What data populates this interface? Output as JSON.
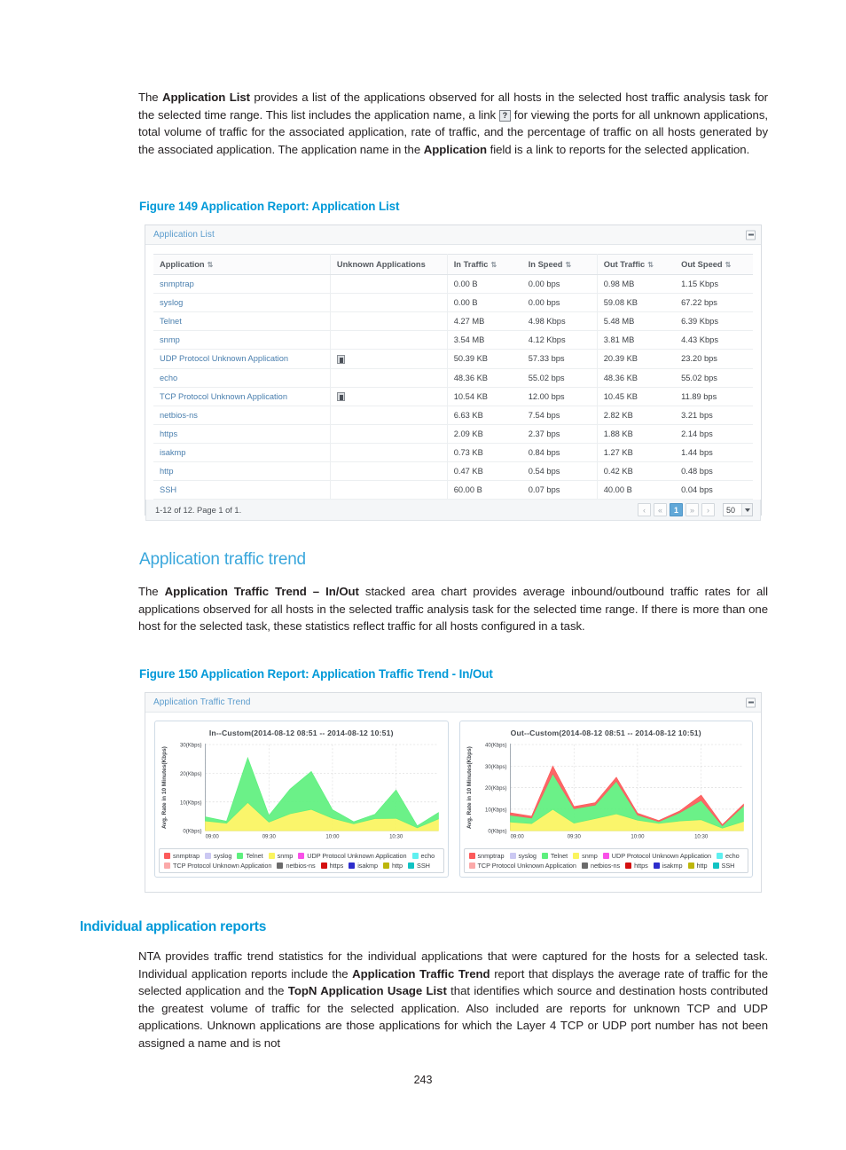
{
  "document": {
    "page_number": "243"
  },
  "intro_paragraph": {
    "segments": [
      {
        "text": "The ",
        "bold": false
      },
      {
        "text": "Application List",
        "bold": true
      },
      {
        "text": " provides a list of the applications observed for all hosts in the selected host traffic analysis task for the selected time range. This list includes the application name, a link ",
        "bold": false
      },
      {
        "text": "[?]",
        "bold": false,
        "icon": true
      },
      {
        "text": " for viewing the ports for all unknown applications, total volume of traffic for the associated application, rate of traffic, and the percentage of traffic on all hosts generated by the associated application. The application name in the ",
        "bold": false
      },
      {
        "text": "Application",
        "bold": true
      },
      {
        "text": " field is a link to reports for the selected application.",
        "bold": false
      }
    ]
  },
  "figure_149": {
    "caption": "Figure 149 Application Report: Application List",
    "panel_title": "Application List",
    "collapse_icon": "minus-icon",
    "table": {
      "columns": [
        {
          "label": "Application",
          "sortable": true
        },
        {
          "label": "Unknown Applications",
          "sortable": false
        },
        {
          "label": "In Traffic",
          "sortable": true
        },
        {
          "label": "In Speed",
          "sortable": true
        },
        {
          "label": "Out Traffic",
          "sortable": true
        },
        {
          "label": "Out Speed",
          "sortable": true
        }
      ],
      "rows": [
        {
          "application": "snmptrap",
          "unknown_icon": false,
          "in_traffic": "0.00 B",
          "in_speed": "0.00 bps",
          "out_traffic": "0.98 MB",
          "out_speed": "1.15 Kbps"
        },
        {
          "application": "syslog",
          "unknown_icon": false,
          "in_traffic": "0.00 B",
          "in_speed": "0.00 bps",
          "out_traffic": "59.08 KB",
          "out_speed": "67.22 bps"
        },
        {
          "application": "Telnet",
          "unknown_icon": false,
          "in_traffic": "4.27 MB",
          "in_speed": "4.98 Kbps",
          "out_traffic": "5.48 MB",
          "out_speed": "6.39 Kbps"
        },
        {
          "application": "snmp",
          "unknown_icon": false,
          "in_traffic": "3.54 MB",
          "in_speed": "4.12 Kbps",
          "out_traffic": "3.81 MB",
          "out_speed": "4.43 Kbps"
        },
        {
          "application": "UDP Protocol Unknown Application",
          "unknown_icon": true,
          "in_traffic": "50.39 KB",
          "in_speed": "57.33 bps",
          "out_traffic": "20.39 KB",
          "out_speed": "23.20 bps"
        },
        {
          "application": "echo",
          "unknown_icon": false,
          "in_traffic": "48.36 KB",
          "in_speed": "55.02 bps",
          "out_traffic": "48.36 KB",
          "out_speed": "55.02 bps"
        },
        {
          "application": "TCP Protocol Unknown Application",
          "unknown_icon": true,
          "in_traffic": "10.54 KB",
          "in_speed": "12.00 bps",
          "out_traffic": "10.45 KB",
          "out_speed": "11.89 bps"
        },
        {
          "application": "netbios-ns",
          "unknown_icon": false,
          "in_traffic": "6.63 KB",
          "in_speed": "7.54 bps",
          "out_traffic": "2.82 KB",
          "out_speed": "3.21 bps"
        },
        {
          "application": "https",
          "unknown_icon": false,
          "in_traffic": "2.09 KB",
          "in_speed": "2.37 bps",
          "out_traffic": "1.88 KB",
          "out_speed": "2.14 bps"
        },
        {
          "application": "isakmp",
          "unknown_icon": false,
          "in_traffic": "0.73 KB",
          "in_speed": "0.84 bps",
          "out_traffic": "1.27 KB",
          "out_speed": "1.44 bps"
        },
        {
          "application": "http",
          "unknown_icon": false,
          "in_traffic": "0.47 KB",
          "in_speed": "0.54 bps",
          "out_traffic": "0.42 KB",
          "out_speed": "0.48 bps"
        },
        {
          "application": "SSH",
          "unknown_icon": false,
          "in_traffic": "60.00 B",
          "in_speed": "0.07 bps",
          "out_traffic": "40.00 B",
          "out_speed": "0.04 bps"
        }
      ],
      "pagination": {
        "summary": "1-12 of 12. Page 1 of 1.",
        "buttons": [
          "‹",
          "«",
          "1",
          "»",
          "›"
        ],
        "active_page": "1",
        "page_size": "50"
      }
    }
  },
  "section_traffic_trend": {
    "heading": "Application traffic trend",
    "paragraph_segments": [
      {
        "text": "The ",
        "bold": false
      },
      {
        "text": "Application Traffic Trend – In/Out",
        "bold": true
      },
      {
        "text": " stacked area chart provides average inbound/outbound traffic rates for all applications observed for all hosts in the selected traffic analysis task for the selected time range. If there is more than one host for the selected task, these statistics reflect traffic for all hosts configured in a task.",
        "bold": false
      }
    ]
  },
  "figure_150": {
    "caption": "Figure 150 Application Report: Application Traffic Trend - In/Out",
    "panel_title": "Application Traffic Trend",
    "collapse_icon": "minus-icon"
  },
  "section_individual": {
    "heading": "Individual application reports",
    "paragraph_segments": [
      {
        "text": "NTA provides traffic trend statistics for the individual applications that were captured for the hosts for a selected task. Individual application reports include the ",
        "bold": false
      },
      {
        "text": "Application Traffic Trend",
        "bold": true
      },
      {
        "text": " report that displays the average rate of traffic for the selected application and the ",
        "bold": false
      },
      {
        "text": "TopN Application Usage List",
        "bold": true
      },
      {
        "text": " that identifies which source and destination hosts contributed the greatest volume of traffic for the selected application. Also included are reports for unknown TCP and UDP applications. Unknown applications are those applications for which the Layer 4 TCP or UDP port number has not been assigned a name and is not",
        "bold": false
      }
    ]
  },
  "legend_series": [
    {
      "name": "snmptrap",
      "color": "#fc5a5a"
    },
    {
      "name": "syslog",
      "color": "#cbc8f2"
    },
    {
      "name": "Telnet",
      "color": "#5ef07e"
    },
    {
      "name": "snmp",
      "color": "#faf45e"
    },
    {
      "name": "UDP Protocol Unknown Application",
      "color": "#f950e8"
    },
    {
      "name": "echo",
      "color": "#5ef0f0"
    },
    {
      "name": "TCP Protocol Unknown Application",
      "color": "#fba9a9"
    },
    {
      "name": "netbios-ns",
      "color": "#6b6b6b"
    },
    {
      "name": "https",
      "color": "#d40f0f"
    },
    {
      "name": "isakmp",
      "color": "#2d2dcc"
    },
    {
      "name": "http",
      "color": "#bdb60b"
    },
    {
      "name": "SSH",
      "color": "#11c3c3"
    }
  ],
  "chart_data": [
    {
      "type": "area",
      "id": "in-chart",
      "title": "In--Custom(2014-08-12 08:51 -- 2014-08-12 10:51)",
      "xlabel": "",
      "ylabel": "Avg. Rate in 10 Minutes(Kbps)",
      "ylim": [
        0,
        30
      ],
      "yticks": [
        0,
        10,
        20,
        30
      ],
      "ytick_labels": [
        "0(Kbps)",
        "10(Kbps)",
        "20(Kbps)",
        "30(Kbps)"
      ],
      "x": [
        "09:00",
        "09:10",
        "09:20",
        "09:30",
        "09:40",
        "09:50",
        "10:00",
        "10:10",
        "10:20",
        "10:30",
        "10:40",
        "10:50"
      ],
      "xticks": [
        "09:00",
        "09:30",
        "10:00",
        "10:30"
      ],
      "grid": true,
      "legend_position": "bottom",
      "stacked": true,
      "series": [
        {
          "name": "snmp",
          "color": "#faf45e",
          "values": [
            3.4,
            2.6,
            9.8,
            3.0,
            5.9,
            7.4,
            4.3,
            2.4,
            4.2,
            4.3,
            1.0,
            4.1
          ]
        },
        {
          "name": "Telnet",
          "color": "#5ef07e",
          "values": [
            1.4,
            0.7,
            15.6,
            2.3,
            8.6,
            13.2,
            3.0,
            0.7,
            1.5,
            9.9,
            0.7,
            2.2
          ]
        }
      ]
    },
    {
      "type": "area",
      "id": "out-chart",
      "title": "Out--Custom(2014-08-12 08:51 -- 2014-08-12 10:51)",
      "xlabel": "",
      "ylabel": "Avg. Rate in 10 Minutes(Kbps)",
      "ylim": [
        0,
        40
      ],
      "yticks": [
        0,
        10,
        20,
        30,
        40
      ],
      "ytick_labels": [
        "0(Kbps)",
        "10(Kbps)",
        "20(Kbps)",
        "30(Kbps)",
        "40(Kbps)"
      ],
      "x": [
        "09:00",
        "09:10",
        "09:20",
        "09:30",
        "09:40",
        "09:50",
        "10:00",
        "10:10",
        "10:20",
        "10:30",
        "10:40",
        "10:50"
      ],
      "xticks": [
        "09:00",
        "09:30",
        "10:00",
        "10:30"
      ],
      "grid": true,
      "legend_position": "bottom",
      "stacked": true,
      "series": [
        {
          "name": "snmp",
          "color": "#faf45e",
          "values": [
            4.0,
            3.3,
            9.9,
            3.5,
            5.6,
            7.8,
            4.9,
            3.4,
            4.5,
            5.1,
            1.2,
            4.3
          ]
        },
        {
          "name": "Telnet",
          "color": "#5ef07e",
          "values": [
            3.2,
            2.6,
            16.6,
            6.7,
            6.3,
            15.2,
            2.4,
            0.8,
            3.9,
            9.0,
            1.1,
            7.2
          ]
        },
        {
          "name": "snmptrap",
          "color": "#fc5a5a",
          "values": [
            1.1,
            0.8,
            3.5,
            1.0,
            1.1,
            1.8,
            0.8,
            0.5,
            0.8,
            2.4,
            0.5,
            0.8
          ]
        }
      ]
    }
  ]
}
